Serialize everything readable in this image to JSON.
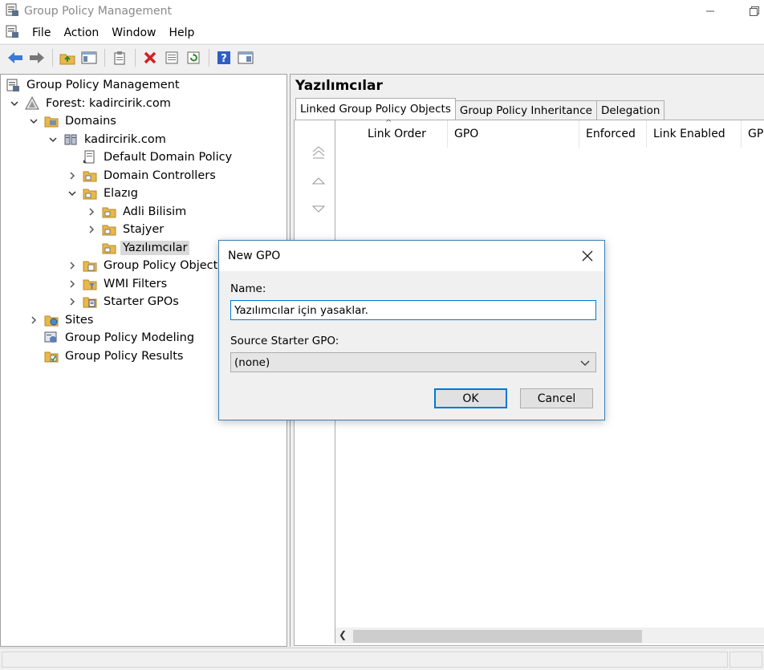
{
  "window": {
    "title": "Group Policy Management"
  },
  "menu": {
    "items": [
      "File",
      "Action",
      "Window",
      "Help"
    ]
  },
  "toolbar": {
    "buttons": [
      "back-arrow-icon",
      "forward-arrow-icon",
      "up-folder-icon",
      "show-hide-tree-icon",
      "clipboard-icon",
      "delete-icon",
      "properties-icon",
      "refresh-icon",
      "help-icon",
      "view-icon"
    ]
  },
  "tree": {
    "root": "Group Policy Management",
    "forest": "Forest: kadircirik.com",
    "domains": "Domains",
    "domain": "kadircirik.com",
    "default_policy": "Default Domain Policy",
    "domain_controllers": "Domain Controllers",
    "elazig": "Elazıg",
    "adli": "Adli Bilisim",
    "stajyer": "Stajyer",
    "yazilimcilar": "Yazılımcılar",
    "gpo": "Group Policy Objects",
    "wmi": "WMI Filters",
    "starter": "Starter GPOs",
    "sites": "Sites",
    "modeling": "Group Policy Modeling",
    "results": "Group Policy Results"
  },
  "right": {
    "title": "Yazılımcılar",
    "tabs": [
      "Linked Group Policy Objects",
      "Group Policy Inheritance",
      "Delegation"
    ],
    "columns": [
      "Link Order",
      "GPO",
      "Enforced",
      "Link Enabled",
      "GP"
    ]
  },
  "dialog": {
    "title": "New GPO",
    "name_label": "Name:",
    "name_value": "Yazılımcılar için yasaklar.",
    "source_label": "Source Starter GPO:",
    "source_value": "(none)",
    "ok": "OK",
    "cancel": "Cancel"
  },
  "colors": {
    "accent": "#0078d7",
    "folder": "#e8b84a"
  }
}
